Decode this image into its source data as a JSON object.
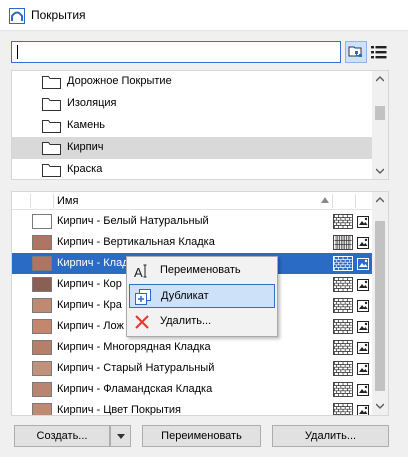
{
  "window": {
    "title": "Покрытия"
  },
  "search": {
    "value": "",
    "placeholder": ""
  },
  "view_buttons": {
    "tree_icon": "folder-tree-icon",
    "list_icon": "list-view-icon"
  },
  "tree": {
    "items": [
      {
        "label": "Дорожное Покрытие",
        "selected": false
      },
      {
        "label": "Изоляция",
        "selected": false
      },
      {
        "label": "Камень",
        "selected": false
      },
      {
        "label": "Кирпич",
        "selected": true
      },
      {
        "label": "Краска",
        "selected": false
      }
    ]
  },
  "list": {
    "column_name": "Имя",
    "sort": "ascending",
    "rows": [
      {
        "name": "Кирпич - Белый Натуральный",
        "color": "#ffffff",
        "hatch": "running-bond",
        "selected": false
      },
      {
        "name": "Кирпич - Вертикальная Кладка",
        "color": "#b07464",
        "hatch": "vertical",
        "selected": false
      },
      {
        "name": "Кирпич - Кладка",
        "color": "#b07464",
        "hatch": "running-bond",
        "selected": true
      },
      {
        "name": "Кирпич - Кор",
        "color": "#8a6055",
        "hatch": "running-bond",
        "selected": false
      },
      {
        "name": "Кирпич - Кра",
        "color": "#bf8a72",
        "hatch": "running-bond",
        "selected": false
      },
      {
        "name": "Кирпич - Лож",
        "color": "#c4866c",
        "hatch": "running-bond",
        "selected": false
      },
      {
        "name": "Кирпич - Многорядная Кладка",
        "color": "#b4806a",
        "hatch": "running-bond",
        "selected": false
      },
      {
        "name": "Кирпич - Старый Натуральный",
        "color": "#c0917d",
        "hatch": "running-bond",
        "selected": false
      },
      {
        "name": "Кирпич - Фламандская Кладка",
        "color": "#b98570",
        "hatch": "running-bond",
        "selected": false
      },
      {
        "name": "Кирпич - Цвет Покрытия",
        "color": "#c08a72",
        "hatch": "running-bond",
        "selected": false
      }
    ]
  },
  "context_menu": {
    "items": [
      {
        "label": "Переименовать",
        "icon": "rename-icon",
        "highlighted": false
      },
      {
        "label": "Дубликат",
        "icon": "duplicate-icon",
        "highlighted": true
      },
      {
        "label": "Удалить...",
        "icon": "delete-x-icon",
        "highlighted": false
      }
    ]
  },
  "buttons": {
    "create": "Создать...",
    "rename": "Переименовать",
    "delete": "Удалить..."
  },
  "colors": {
    "selection": "#2a6bc6",
    "menu_highlight": "#cde2f8",
    "delete_icon": "#e8342b"
  }
}
